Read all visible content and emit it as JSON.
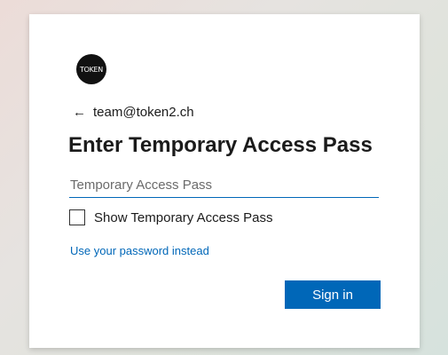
{
  "brand": {
    "logo_text": "TOKEN"
  },
  "identity": {
    "back_icon": "←",
    "email": "team@token2.ch"
  },
  "title": "Enter Temporary Access Pass",
  "tap_field": {
    "placeholder": "Temporary Access Pass",
    "value": ""
  },
  "show_checkbox": {
    "label": "Show Temporary Access Pass",
    "checked": false
  },
  "alt_link": "Use your password instead",
  "signin_button": "Sign in",
  "colors": {
    "accent": "#0067b8",
    "text": "#1b1b1b"
  }
}
